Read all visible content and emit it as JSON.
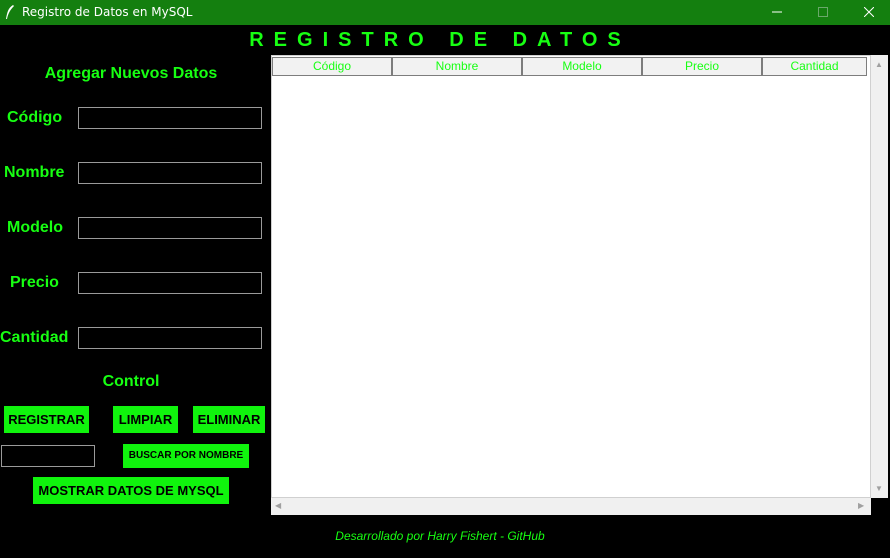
{
  "window": {
    "title": "Registro de Datos en MySQL",
    "minimize_icon": "minimize-icon",
    "maximize_icon": "maximize-icon",
    "close_icon": "close-icon"
  },
  "heading": "REGISTRO DE DATOS",
  "form": {
    "title": "Agregar Nuevos Datos",
    "fields": [
      {
        "label": "Código",
        "value": ""
      },
      {
        "label": "Nombre",
        "value": ""
      },
      {
        "label": "Modelo",
        "value": ""
      },
      {
        "label": "Precio",
        "value": ""
      },
      {
        "label": "Cantidad",
        "value": ""
      }
    ]
  },
  "control": {
    "title": "Control",
    "registrar": "REGISTRAR",
    "limpiar": "LIMPIAR",
    "eliminar": "ELIMINAR",
    "search_value": "",
    "buscar": "BUSCAR POR NOMBRE",
    "mostrar": "MOSTRAR DATOS DE MYSQL"
  },
  "table": {
    "columns": [
      "Código",
      "Nombre",
      "Modelo",
      "Precio",
      "Cantidad"
    ],
    "rows": []
  },
  "footer": "Desarrollado por Harry Fishert - GitHub",
  "colors": {
    "accent": "#17ff12",
    "button": "#10f40d",
    "titlebar": "#147f0f",
    "background": "#000000"
  }
}
